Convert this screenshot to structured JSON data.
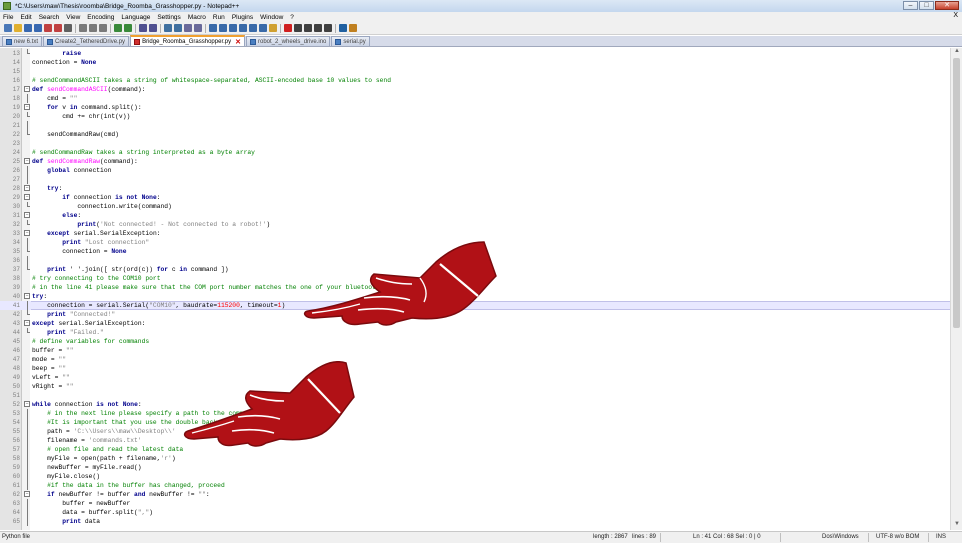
{
  "window": {
    "title": "*C:\\Users\\maw\\Thesis\\roomba\\Bridge_Roomba_Grasshopper.py - Notepad++"
  },
  "menu": [
    "File",
    "Edit",
    "Search",
    "View",
    "Encoding",
    "Language",
    "Settings",
    "Macro",
    "Run",
    "Plugins",
    "Window",
    "?"
  ],
  "menu_close": "X",
  "toolbar": {
    "icons": [
      "new-file-icon",
      "open-icon",
      "save-icon",
      "save-all-icon",
      "close-icon",
      "close-all-icon",
      "print-icon",
      "cut-icon",
      "copy-icon",
      "paste-icon",
      "undo-icon",
      "redo-icon",
      "find-icon",
      "replace-icon",
      "zoom-in-icon",
      "zoom-out-icon",
      "sync-v-icon",
      "sync-h-icon",
      "wrap-icon",
      "all-chars-icon",
      "indent-guide-icon",
      "lang-icon",
      "doc-map-icon",
      "function-list-icon",
      "folder-icon",
      "record-icon",
      "stop-icon",
      "play-icon",
      "play-multi-icon",
      "save-macro-icon",
      "spell-icon",
      "abc-icon"
    ]
  },
  "tabs": [
    {
      "label": "new 6.txt",
      "active": false
    },
    {
      "label": "Create2_TetheredDrive.py",
      "active": false
    },
    {
      "label": "Bridge_Roomba_Grasshopper.py",
      "active": true
    },
    {
      "label": "robot_2_wheels_drive.ino",
      "active": false
    },
    {
      "label": "serial.py",
      "active": false
    }
  ],
  "code_lines": [
    {
      "n": "13",
      "fold": "end",
      "parts": [
        [
          "t",
          "        "
        ],
        [
          "kw",
          "raise"
        ]
      ]
    },
    {
      "n": "14",
      "fold": "",
      "parts": [
        [
          "t",
          "connection = "
        ],
        [
          "kw",
          "None"
        ]
      ]
    },
    {
      "n": "15",
      "fold": "",
      "parts": []
    },
    {
      "n": "16",
      "fold": "",
      "parts": [
        [
          "cm",
          "# sendCommandASCII takes a string of whitespace-separated, ASCII-encoded base 10 values to send"
        ]
      ]
    },
    {
      "n": "17",
      "fold": "box",
      "parts": [
        [
          "kw",
          "def "
        ],
        [
          "fn",
          "sendCommandASCII"
        ],
        [
          "t",
          "(command):"
        ]
      ]
    },
    {
      "n": "18",
      "fold": "vline",
      "parts": [
        [
          "t",
          "    cmd = "
        ],
        [
          "str",
          "\"\""
        ]
      ]
    },
    {
      "n": "19",
      "fold": "box",
      "parts": [
        [
          "t",
          "    "
        ],
        [
          "kw",
          "for"
        ],
        [
          "t",
          " v "
        ],
        [
          "kw",
          "in"
        ],
        [
          "t",
          " command.split():"
        ]
      ]
    },
    {
      "n": "20",
      "fold": "end",
      "parts": [
        [
          "t",
          "        cmd += chr(int(v))"
        ]
      ]
    },
    {
      "n": "21",
      "fold": "vline",
      "parts": []
    },
    {
      "n": "22",
      "fold": "end",
      "parts": [
        [
          "t",
          "    sendCommandRaw(cmd)"
        ]
      ]
    },
    {
      "n": "23",
      "fold": "",
      "parts": []
    },
    {
      "n": "24",
      "fold": "",
      "parts": [
        [
          "cm",
          "# sendCommandRaw takes a string interpreted as a byte array"
        ]
      ]
    },
    {
      "n": "25",
      "fold": "box",
      "parts": [
        [
          "kw",
          "def "
        ],
        [
          "fn",
          "sendCommandRaw"
        ],
        [
          "t",
          "(command):"
        ]
      ]
    },
    {
      "n": "26",
      "fold": "vline",
      "parts": [
        [
          "t",
          "    "
        ],
        [
          "kw",
          "global"
        ],
        [
          "t",
          " connection"
        ]
      ]
    },
    {
      "n": "27",
      "fold": "vline",
      "parts": []
    },
    {
      "n": "28",
      "fold": "box",
      "parts": [
        [
          "t",
          "    "
        ],
        [
          "kw",
          "try"
        ],
        [
          "t",
          ":"
        ]
      ]
    },
    {
      "n": "29",
      "fold": "box",
      "parts": [
        [
          "t",
          "        "
        ],
        [
          "kw",
          "if"
        ],
        [
          "t",
          " connection "
        ],
        [
          "kw",
          "is not"
        ],
        [
          "t",
          " "
        ],
        [
          "kw",
          "None"
        ],
        [
          "t",
          ":"
        ]
      ]
    },
    {
      "n": "30",
      "fold": "end",
      "parts": [
        [
          "t",
          "            connection.write(command)"
        ]
      ]
    },
    {
      "n": "31",
      "fold": "box",
      "parts": [
        [
          "t",
          "        "
        ],
        [
          "kw",
          "else"
        ],
        [
          "t",
          ":"
        ]
      ]
    },
    {
      "n": "32",
      "fold": "end",
      "parts": [
        [
          "t",
          "            "
        ],
        [
          "kw",
          "print"
        ],
        [
          "t",
          "("
        ],
        [
          "str",
          "'Not connected! - Not connected to a robot!'"
        ],
        [
          "t",
          ")"
        ]
      ]
    },
    {
      "n": "33",
      "fold": "box",
      "parts": [
        [
          "t",
          "    "
        ],
        [
          "kw",
          "except"
        ],
        [
          "t",
          " serial.SerialException:"
        ]
      ]
    },
    {
      "n": "34",
      "fold": "vline",
      "parts": [
        [
          "t",
          "        "
        ],
        [
          "kw",
          "print"
        ],
        [
          "t",
          " "
        ],
        [
          "str",
          "\"Lost connection\""
        ]
      ]
    },
    {
      "n": "35",
      "fold": "end",
      "parts": [
        [
          "t",
          "        connection = "
        ],
        [
          "kw",
          "None"
        ]
      ]
    },
    {
      "n": "36",
      "fold": "vline",
      "parts": []
    },
    {
      "n": "37",
      "fold": "end",
      "parts": [
        [
          "t",
          "    "
        ],
        [
          "kw",
          "print"
        ],
        [
          "t",
          " ' '.join([ str(ord(c)) "
        ],
        [
          "kw",
          "for"
        ],
        [
          "t",
          " c "
        ],
        [
          "kw",
          "in"
        ],
        [
          "t",
          " command ])"
        ]
      ]
    },
    {
      "n": "38",
      "fold": "",
      "parts": [
        [
          "cm",
          "# try connecting to the COM10 port"
        ]
      ]
    },
    {
      "n": "39",
      "fold": "",
      "parts": [
        [
          "cm",
          "# in the line 41 please make sure that the COM port number matches the one of your bluetooth port"
        ]
      ]
    },
    {
      "n": "40",
      "fold": "box",
      "parts": [
        [
          "kw",
          "try"
        ],
        [
          "t",
          ":"
        ]
      ]
    },
    {
      "n": "41",
      "fold": "vline",
      "current": true,
      "parts": [
        [
          "t",
          "    connection = serial.Serial("
        ],
        [
          "str",
          "\"COM10\""
        ],
        [
          "t",
          ", baudrate="
        ],
        [
          "num",
          "115200"
        ],
        [
          "t",
          ", timeout="
        ],
        [
          "num",
          "1"
        ],
        [
          "t",
          ")"
        ]
      ]
    },
    {
      "n": "42",
      "fold": "end",
      "parts": [
        [
          "t",
          "    "
        ],
        [
          "kw",
          "print"
        ],
        [
          "t",
          " "
        ],
        [
          "str",
          "\"Connected!\""
        ]
      ]
    },
    {
      "n": "43",
      "fold": "box",
      "parts": [
        [
          "kw",
          "except"
        ],
        [
          "t",
          " serial.SerialException:"
        ]
      ]
    },
    {
      "n": "44",
      "fold": "end",
      "parts": [
        [
          "t",
          "    "
        ],
        [
          "kw",
          "print"
        ],
        [
          "t",
          " "
        ],
        [
          "str",
          "\"Failed.\""
        ]
      ]
    },
    {
      "n": "45",
      "fold": "",
      "parts": [
        [
          "cm",
          "# define variables for commands"
        ]
      ]
    },
    {
      "n": "46",
      "fold": "",
      "parts": [
        [
          "t",
          "buffer = "
        ],
        [
          "str",
          "\"\""
        ]
      ]
    },
    {
      "n": "47",
      "fold": "",
      "parts": [
        [
          "t",
          "mode = "
        ],
        [
          "str",
          "\"\""
        ]
      ]
    },
    {
      "n": "48",
      "fold": "",
      "parts": [
        [
          "t",
          "beep = "
        ],
        [
          "str",
          "\"\""
        ]
      ]
    },
    {
      "n": "49",
      "fold": "",
      "parts": [
        [
          "t",
          "vLeft = "
        ],
        [
          "str",
          "\"\""
        ]
      ]
    },
    {
      "n": "50",
      "fold": "",
      "parts": [
        [
          "t",
          "vRight = "
        ],
        [
          "str",
          "\"\""
        ]
      ]
    },
    {
      "n": "51",
      "fold": "",
      "parts": []
    },
    {
      "n": "52",
      "fold": "box",
      "parts": [
        [
          "kw",
          "while"
        ],
        [
          "t",
          " connection "
        ],
        [
          "kw",
          "is not"
        ],
        [
          "t",
          " "
        ],
        [
          "kw",
          "None"
        ],
        [
          "t",
          ":"
        ]
      ]
    },
    {
      "n": "53",
      "fold": "vline",
      "parts": [
        [
          "t",
          "    "
        ],
        [
          "cm",
          "# in the next line please specify a path to the commands file"
        ]
      ]
    },
    {
      "n": "54",
      "fold": "vline",
      "parts": [
        [
          "t",
          "    "
        ],
        [
          "cm",
          "#It is important that you use the double backslashes"
        ]
      ]
    },
    {
      "n": "55",
      "fold": "vline",
      "parts": [
        [
          "t",
          "    path = "
        ],
        [
          "str",
          "'C:\\\\Users\\\\maw\\\\Desktop\\\\'"
        ]
      ]
    },
    {
      "n": "56",
      "fold": "vline",
      "parts": [
        [
          "t",
          "    filename = "
        ],
        [
          "str",
          "'commands.txt'"
        ]
      ]
    },
    {
      "n": "57",
      "fold": "vline",
      "parts": [
        [
          "t",
          "    "
        ],
        [
          "cm",
          "# open file and read the latest data"
        ]
      ]
    },
    {
      "n": "58",
      "fold": "vline",
      "parts": [
        [
          "t",
          "    myFile = open(path + filename,"
        ],
        [
          "str",
          "'r'"
        ],
        [
          "t",
          ")"
        ]
      ]
    },
    {
      "n": "59",
      "fold": "vline",
      "parts": [
        [
          "t",
          "    newBuffer = myFile.read()"
        ]
      ]
    },
    {
      "n": "60",
      "fold": "vline",
      "parts": [
        [
          "t",
          "    myFile.close()"
        ]
      ]
    },
    {
      "n": "61",
      "fold": "vline",
      "parts": [
        [
          "t",
          "    "
        ],
        [
          "cm",
          "#if the data in the buffer has changed, proceed"
        ]
      ]
    },
    {
      "n": "62",
      "fold": "box",
      "parts": [
        [
          "t",
          "    "
        ],
        [
          "kw",
          "if"
        ],
        [
          "t",
          " newBuffer != buffer "
        ],
        [
          "kw",
          "and"
        ],
        [
          "t",
          " newBuffer != "
        ],
        [
          "str",
          "\"\""
        ],
        [
          "t",
          ":"
        ]
      ]
    },
    {
      "n": "63",
      "fold": "vline",
      "parts": [
        [
          "t",
          "        buffer = newBuffer"
        ]
      ]
    },
    {
      "n": "64",
      "fold": "vline",
      "parts": [
        [
          "t",
          "        data = buffer.split("
        ],
        [
          "str",
          "\",\""
        ],
        [
          "t",
          ")"
        ]
      ]
    },
    {
      "n": "65",
      "fold": "vline",
      "parts": [
        [
          "t",
          "        "
        ],
        [
          "kw",
          "print"
        ],
        [
          "t",
          " data"
        ]
      ]
    }
  ],
  "status": {
    "file_type": "Python file",
    "length": "length : 2867",
    "lines": "lines : 89",
    "position": "Ln : 41   Col : 68   Sel : 0 | 0",
    "eol": "Dos\\Windows",
    "encoding": "UTF-8 w/o BOM",
    "mode": "INS"
  },
  "colors": {
    "hand_red": "#b11116",
    "current_line": "#e8e8ff"
  }
}
